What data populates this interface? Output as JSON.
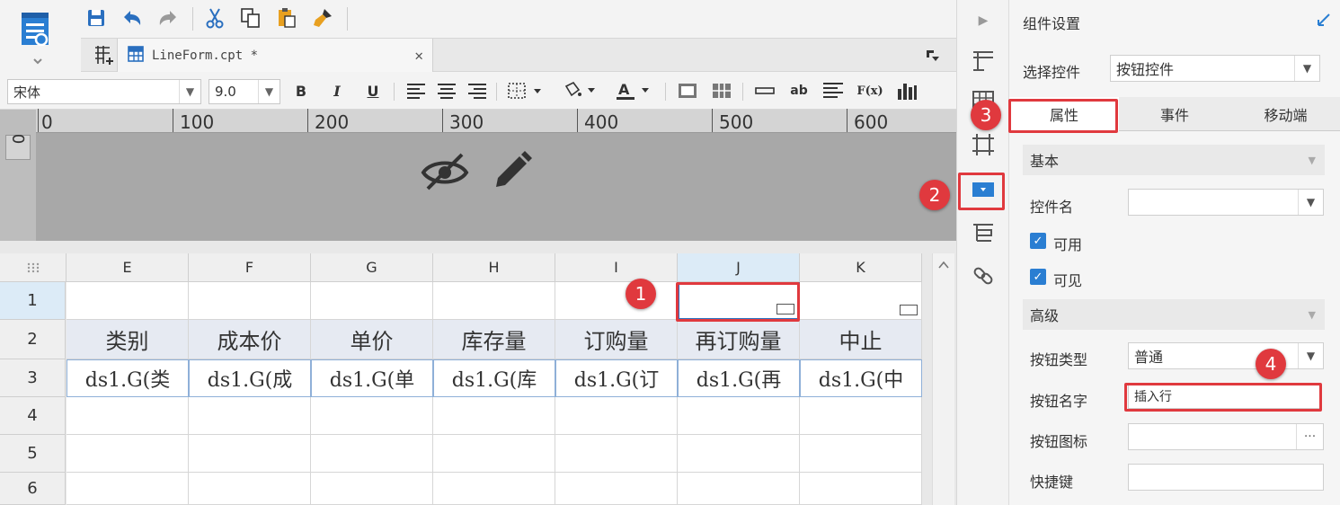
{
  "toolbar": {
    "icons": [
      "save-icon",
      "undo-icon",
      "redo-icon",
      "cut-icon",
      "copy-icon",
      "paste-icon",
      "format-brush-icon"
    ]
  },
  "tab": {
    "title": "LineForm.cpt *",
    "close": "✕"
  },
  "font": {
    "family": "宋体",
    "size": "9.0"
  },
  "format_buttons": {
    "bold": "B",
    "italic": "I",
    "underline": "U",
    "ab": "ab",
    "fx": "F(x)"
  },
  "ruler": {
    "labels": [
      "0",
      "100",
      "200",
      "300",
      "400",
      "500",
      "600"
    ],
    "vlabel": "0"
  },
  "grid": {
    "columns": [
      "E",
      "F",
      "G",
      "H",
      "I",
      "J",
      "K"
    ],
    "rows": [
      "1",
      "2",
      "3",
      "4",
      "5",
      "6"
    ],
    "header_row": [
      "类别",
      "成本价",
      "单价",
      "库存量",
      "订购量",
      "再订购量",
      "中止"
    ],
    "data_row": [
      "ds1.G(类",
      "ds1.G(成",
      "ds1.G(单",
      "ds1.G(库",
      "ds1.G(订",
      "ds1.G(再",
      "ds1.G(中"
    ]
  },
  "panel": {
    "title": "组件设置",
    "select_label": "选择控件",
    "select_value": "按钮控件",
    "tabs": [
      "属性",
      "事件",
      "移动端"
    ],
    "basic_section": "基本",
    "name_label": "控件名",
    "name_value": "",
    "enabled_label": "可用",
    "visible_label": "可见",
    "advanced_section": "高级",
    "btn_type_label": "按钮类型",
    "btn_type_value": "普通",
    "btn_name_label": "按钮名字",
    "btn_name_value": "插入行",
    "btn_icon_label": "按钮图标",
    "btn_icon_more": "···",
    "shortcut_label": "快捷键"
  },
  "badges": [
    "1",
    "2",
    "3",
    "4"
  ],
  "colors": {
    "accent": "#2a7ed2",
    "badge": "#e0393e",
    "header_fill": "#e6eaf2"
  }
}
